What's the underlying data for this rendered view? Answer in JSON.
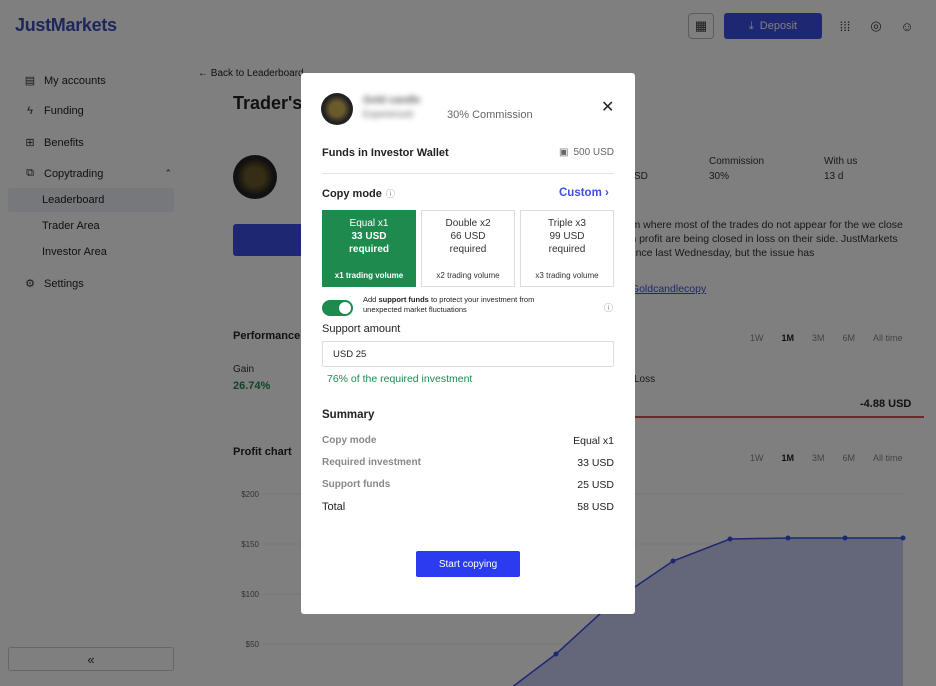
{
  "header": {
    "logo": "JustMarkets",
    "deposit_label": "Deposit",
    "accent": "#3b4fe4"
  },
  "sidebar": {
    "items": [
      {
        "label": "My accounts",
        "icon": "wallet-icon"
      },
      {
        "label": "Funding",
        "icon": "funding-icon"
      },
      {
        "label": "Benefits",
        "icon": "gift-icon"
      },
      {
        "label": "Copytrading",
        "icon": "copytrading-icon"
      },
      {
        "label": "Settings",
        "icon": "gear-icon"
      }
    ],
    "copytrading_sub": [
      "Leaderboard",
      "Trader Area",
      "Investor Area"
    ],
    "collapse_label": "«"
  },
  "main": {
    "back_label": "Back to Leaderboard",
    "title": "Trader's",
    "stats": [
      {
        "label": "Commission",
        "value": "30%"
      },
      {
        "label": "With us",
        "value": "13 d"
      }
    ],
    "stat_partial": "SD",
    "description": "rm where most of the trades do not appear for the we close in profit are being closed in loss on their side. JustMarkets since last Wednesday, but the issue has",
    "link": "/Goldcandlecopy",
    "performance_title": "Performance",
    "periods": [
      "1W",
      "1M",
      "3M",
      "6M",
      "All time"
    ],
    "active_period": "1M",
    "gain_label": "Gain",
    "gain_value": "26.74%",
    "loss_label": "Loss",
    "loss_value": "-4.88 USD",
    "profit_chart_title": "Profit chart"
  },
  "chart_data": {
    "type": "area",
    "y_ticks": [
      "$200",
      "$150",
      "$100",
      "$50"
    ],
    "ylim": [
      0,
      220
    ],
    "values": [
      0,
      40,
      92,
      133,
      155,
      156,
      156,
      156
    ]
  },
  "modal": {
    "trader_name": "Gold candle",
    "trader_tag": "Experienced",
    "commission": "30% Commission",
    "funds_label": "Funds in Investor Wallet",
    "funds_value": "500 USD",
    "copy_mode_label": "Copy mode",
    "custom_label": "Custom",
    "options": [
      {
        "title": "Equal x1",
        "amount": "33 USD",
        "req": "required",
        "volume": "x1 trading volume"
      },
      {
        "title": "Double x2",
        "amount": "66 USD",
        "req": "required",
        "volume": "x2 trading volume"
      },
      {
        "title": "Triple x3",
        "amount": "99 USD",
        "req": "required",
        "volume": "x3 trading volume"
      }
    ],
    "support_pre": "Add ",
    "support_bold": "support funds",
    "support_post": " to protect your investment from unexpected market fluctuations",
    "support_amount_label": "Support amount",
    "support_amount_value": "USD 25",
    "percent_text": "76% of the required investment",
    "summary_title": "Summary",
    "summary": [
      {
        "k": "Copy mode",
        "v": "Equal x1"
      },
      {
        "k": "Required investment",
        "v": "33 USD"
      },
      {
        "k": "Support funds",
        "v": "25 USD"
      },
      {
        "k": "Total",
        "v": "58 USD"
      }
    ],
    "start_label": "Start copying"
  }
}
